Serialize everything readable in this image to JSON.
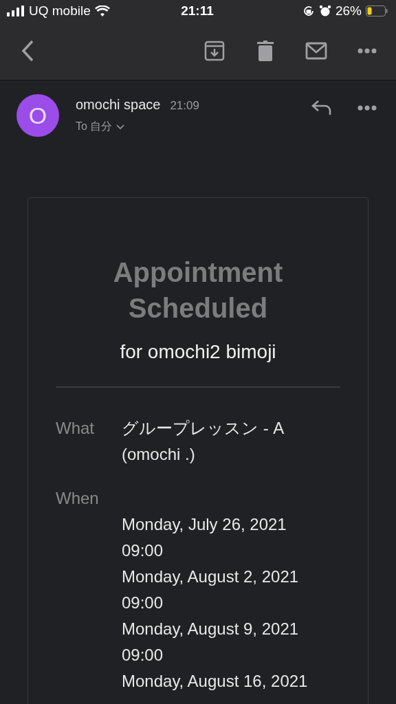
{
  "status_bar": {
    "carrier": "UQ mobile",
    "time": "21:11",
    "battery": "26%"
  },
  "message": {
    "avatar": "O",
    "sender": "omochi space",
    "time": "21:09",
    "recipient": "To 自分"
  },
  "card": {
    "title": "Appointment Scheduled",
    "subtitle": "for omochi2 bimoji",
    "fields": [
      {
        "label": "What",
        "values": [
          "グループレッスン - A (omochi .)"
        ]
      },
      {
        "label": "When",
        "values": [
          "Monday, July 26, 2021",
          "09:00",
          "Monday, August 2, 2021",
          "09:00",
          "Monday, August 9, 2021",
          "09:00",
          "Monday, August 16, 2021"
        ]
      }
    ]
  }
}
